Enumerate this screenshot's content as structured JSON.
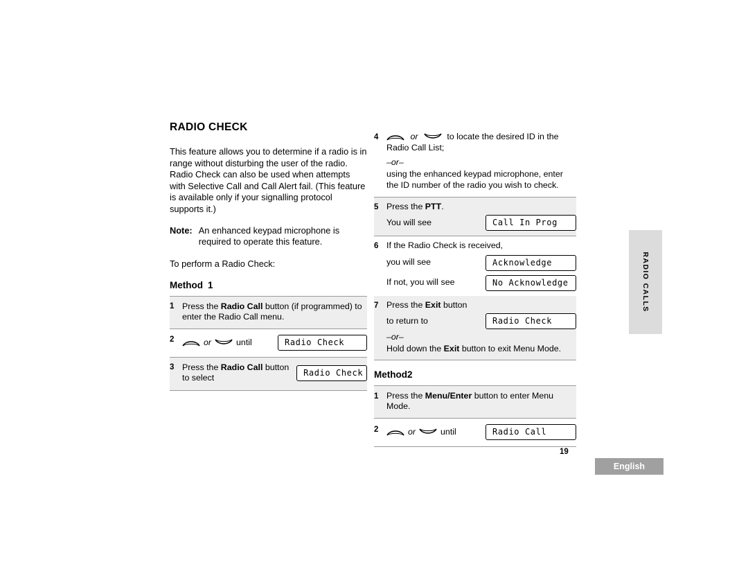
{
  "document": {
    "heading": "RADIO CHECK",
    "intro": "This feature allows you to determine if a radio is in range without disturbing the user of the radio. Radio Check can also be used when attempts with Selective Call and Call Alert fail. (This feature is available only if your signalling protocol supports it.)",
    "note_label": "Note:",
    "note_text": "An enhanced keypad microphone is required to operate this feature.",
    "lead_line": "To perform a Radio Check:",
    "method1": {
      "title": "Method",
      "number": "1",
      "steps": [
        {
          "num": "1",
          "text_before": "Press the ",
          "bold": "Radio Call",
          "text_after": " button (if programmed) to enter the Radio Call menu."
        },
        {
          "num": "2",
          "or": "or",
          "until": "until",
          "display": "Radio Check"
        },
        {
          "num": "3",
          "text_before": "Press the ",
          "bold": "Radio Call",
          "text_after": " button to select",
          "display": "Radio Check"
        }
      ]
    },
    "method2": {
      "title": "Method",
      "number": "2",
      "steps": [
        {
          "num": "1",
          "text_before": "Press the ",
          "bold": "Menu/Enter",
          "text_after": " button to enter Menu Mode."
        },
        {
          "num": "2",
          "or": "or",
          "until": "until",
          "display": "Radio Call"
        }
      ]
    },
    "right_steps": {
      "step4": {
        "num": "4",
        "or": "or",
        "text": "to locate the desired ID in the Radio Call List;",
        "or_divider": "–or–",
        "continuation": "using the enhanced keypad microphone, enter the ID number of the radio you wish to check."
      },
      "step5": {
        "num": "5",
        "text_before": "Press the ",
        "bold": "PTT",
        "text_after": ".",
        "sub": "You will see",
        "display": "Call In Prog"
      },
      "step6": {
        "num": "6",
        "text": "If the Radio Check is received,",
        "sub1": "you will see",
        "display1": "Acknowledge",
        "sub2": "If not, you will see",
        "display2": "No Acknowledge"
      },
      "step7": {
        "num": "7",
        "text_before": "Press the ",
        "bold": "Exit",
        "text_after": " button",
        "sub": "to return to",
        "display": "Radio Check",
        "or_divider": "–or–",
        "closing_before": "Hold down the ",
        "closing_bold": "Exit",
        "closing_after": " button to exit Menu Mode."
      }
    }
  },
  "side_tab": {
    "label": "RADIO CALLS"
  },
  "footer": {
    "page_number": "19",
    "language": "English"
  },
  "icons": {
    "up_arrow_key": "arrow-up-key-icon",
    "down_arrow_key": "arrow-down-key-icon"
  },
  "colors": {
    "shade": "#eeeeee",
    "tab_gray": "#dcdcdc",
    "badge_gray": "#a0a0a0"
  }
}
